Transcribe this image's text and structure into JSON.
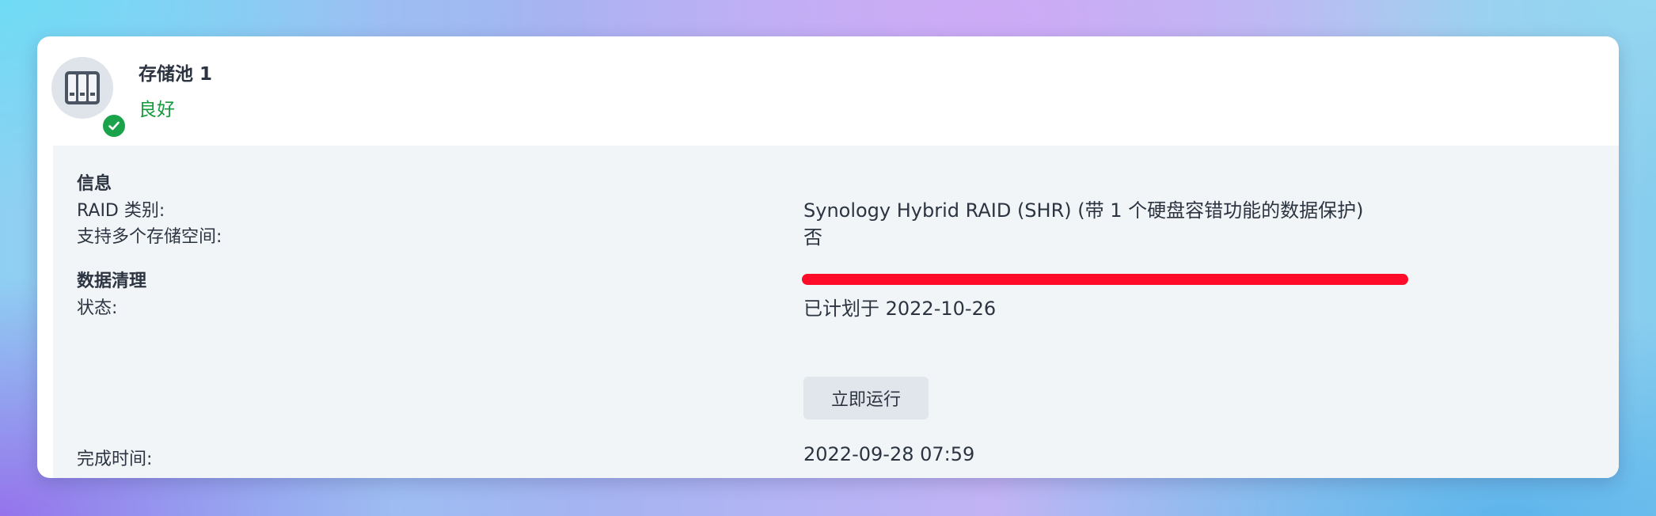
{
  "pool": {
    "title": "存储池 1",
    "status": "良好",
    "status_color": "#149a3d",
    "icon": "nas-drive-bays-icon",
    "status_icon": "check-circle-icon"
  },
  "info": {
    "heading": "信息",
    "raid_type_label": "RAID 类别:",
    "raid_type_value": "Synology Hybrid RAID (SHR) (带 1 个硬盘容错功能的数据保护)",
    "multi_volume_label": "支持多个存储空间:",
    "multi_volume_value": "否"
  },
  "scrubbing": {
    "heading": "数据清理",
    "status_label": "状态:",
    "status_value": "已计划于 2022-10-26",
    "run_now_label": "立即运行",
    "completed_label": "完成时间:",
    "completed_value": "2022-09-28 07:59"
  },
  "annotation": {
    "highlight_color": "#ff0b2a"
  }
}
